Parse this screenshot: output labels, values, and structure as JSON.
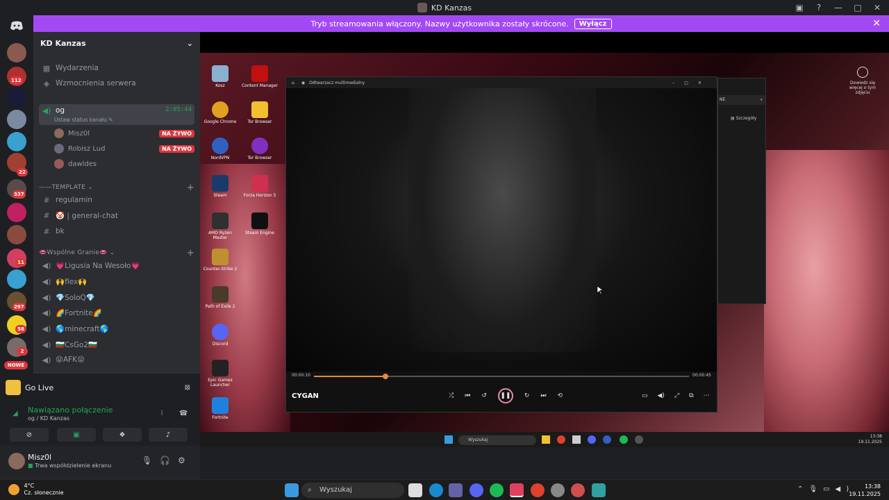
{
  "window": {
    "title": "KD Kanzas"
  },
  "banner": {
    "text": "Tryb streamowania włączony. Nazwy użytkownika zostały skrócone.",
    "button_label": "Wyłącz",
    "color": "#a349f4"
  },
  "guilds": {
    "badges": [
      "112",
      "22",
      "337",
      "11",
      "297",
      "58",
      "2",
      "NOWE"
    ]
  },
  "server": {
    "name": "KD Kanzas",
    "top_items": [
      {
        "label": "Wydarzenia"
      },
      {
        "label": "Wzmocnienia serwera"
      }
    ],
    "voice_channel": {
      "name": "og",
      "timer": "2:05:44",
      "status_label": "Ustaw status kanału",
      "users": [
        {
          "name": "Misz0l",
          "live_label": "NA ŻYWO"
        },
        {
          "name": "Robisz Lud",
          "live_label": "NA ŻYWO"
        },
        {
          "name": "dawldes",
          "live_label": ""
        }
      ]
    },
    "category_template": "TEMPLATE",
    "text_channels": [
      {
        "name": "regulamin"
      },
      {
        "name": "🤡 | general-chat"
      },
      {
        "name": "bk"
      }
    ],
    "category_shared": "Wspólne Granie",
    "shared_channels": [
      {
        "name": "💗Ligusia Na Wesoło💗"
      },
      {
        "name": "🙌flex🙌"
      },
      {
        "name": "💎SoloQ💎"
      },
      {
        "name": "🌈Fortnite🌈"
      },
      {
        "name": "🌎minecraft🌎"
      },
      {
        "name": "🇧🇬CsGo2🇧🇬"
      },
      {
        "name": "😝AFK😝"
      }
    ]
  },
  "golive": {
    "label": "Go Live"
  },
  "voice_panel": {
    "title": "Nawiązano połączenie",
    "subtitle": "og / KD Kanzas"
  },
  "user": {
    "name": "Misz0l",
    "status": "Trwa współdzielenie ekranu"
  },
  "stream": {
    "desktop_icons": [
      "Kosz",
      "Content Manager",
      "Google Chrome",
      "Tor Browser",
      "NordVPN",
      "Tor Browser",
      "Steam",
      "Forza Horizon 5",
      "AMD Ryzen Master",
      "Steam Engine",
      "Counter-Strike 2",
      "Path of Exile 2",
      "Discord",
      "Epic Games Launcher",
      "Fortnite"
    ],
    "player": {
      "app_name": "Odtwarzacz multimedialny",
      "title": "CYGAN",
      "time_current": "00:00:10",
      "time_total": "00:00:45",
      "progress": 0.19
    },
    "side_window": {
      "label": "Szczegóły"
    },
    "right_hint": "Dowiedz się więcej o tym zdjęciu",
    "inner_search": "Wyszukaj",
    "inner_clock": {
      "time": "13:38",
      "date": "19.11.2025"
    }
  },
  "taskbar": {
    "weather_temp": "4°C",
    "weather_desc": "Cz. słonecznie",
    "search_placeholder": "Wyszukaj",
    "time": "13:38",
    "date": "19.11.2025"
  }
}
